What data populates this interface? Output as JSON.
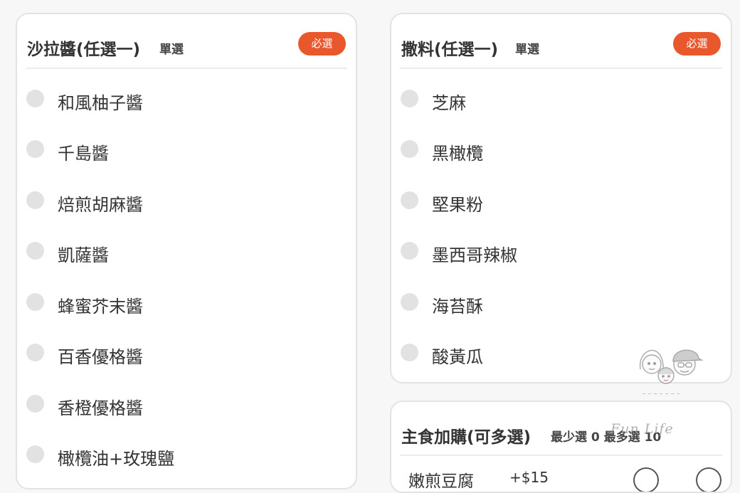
{
  "sauce_card": {
    "title": "沙拉醬(任選一)",
    "subtitle": "單選",
    "badge": "必選",
    "options": [
      {
        "label": "和風柚子醬"
      },
      {
        "label": "千島醬"
      },
      {
        "label": "焙煎胡麻醬"
      },
      {
        "label": "凱薩醬"
      },
      {
        "label": "蜂蜜芥末醬"
      },
      {
        "label": "百香優格醬"
      },
      {
        "label": "香橙優格醬"
      },
      {
        "label": "橄欖油+玫瑰鹽"
      }
    ]
  },
  "topping_card": {
    "title": "撒料(任選一)",
    "subtitle": "單選",
    "badge": "必選",
    "options": [
      {
        "label": "芝麻"
      },
      {
        "label": "黑橄欖"
      },
      {
        "label": "堅果粉"
      },
      {
        "label": "墨西哥辣椒"
      },
      {
        "label": "海苔酥"
      },
      {
        "label": "酸黃瓜"
      }
    ]
  },
  "addon_card": {
    "title": "主食加購(可多選)",
    "subtitle": "最少選 0 最多選 10",
    "item": {
      "name": "嫩煎豆腐",
      "price": "+$15"
    }
  },
  "watermark": {
    "text": "Fun Life"
  },
  "colors": {
    "accent": "#e8582c",
    "radio": "#e2e2e2",
    "border": "#e3e3e3"
  }
}
